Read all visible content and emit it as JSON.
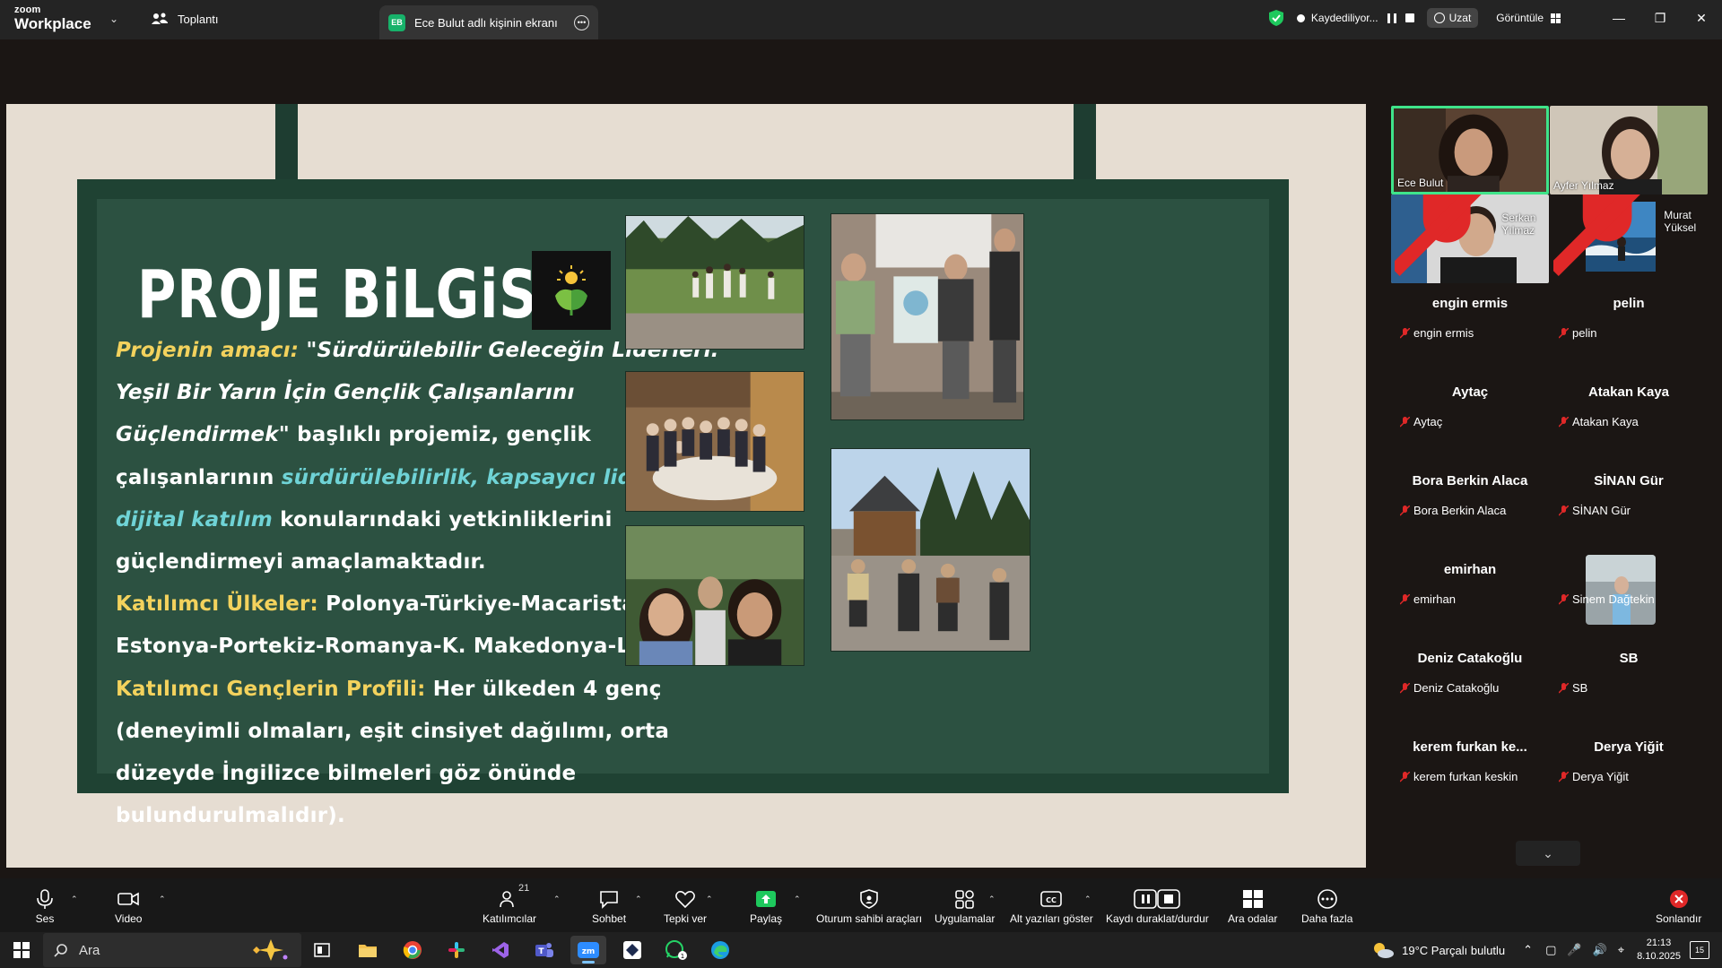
{
  "app": {
    "logo_line1": "zoom",
    "logo_line2": "Workplace",
    "meeting_tab": "Toplantı",
    "screen_tab_badge": "EB",
    "screen_tab_label": "Ece Bulut adlı kişinin ekranı",
    "recording_label": "Kaydediliyor...",
    "extend_label": "Uzat",
    "view_label": "Görüntüle"
  },
  "slide": {
    "title": "PROJE BiLGiSi",
    "purpose_label": "Projenin amacı:",
    "purpose_quote": "\"Sürdürülebilir Geleceğin Liderleri: Yeşil Bir Yarın İçin Gençlik Çalışanlarını Güçlendirmek\"",
    "purpose_mid": " başlıklı projemiz, gençlik çalışanlarının ",
    "purpose_topics": "sürdürülebilirlik, kapsayıcı liderlik ve dijital katılım",
    "purpose_end": " konularındaki yetkinliklerini güçlendirmeyi amaçlamaktadır.",
    "countries_label": "Katılımcı Ülkeler:",
    "countries_value": " Polonya-Türkiye-Macaristan-Estonya-Portekiz-Romanya-K. Makedonya-Litvanya",
    "profile_label": "Katılımcı Gençlerin Profili:",
    "profile_value": " Her ülkeden 4 genç (deneyimli olmaları, eşit cinsiyet dağılımı, orta düzeyde İngilizce bilmeleri göz önünde bulundurulmalıdır)."
  },
  "gallery": {
    "video_tiles": [
      {
        "name": "Ece Bulut",
        "muted": false,
        "active": true
      },
      {
        "name": "Ayfer Yılmaz",
        "muted": false,
        "active": false
      },
      {
        "name": "Serkan Yılmaz",
        "muted": true,
        "active": false
      },
      {
        "name": "Murat Yüksel",
        "muted": true,
        "active": false
      }
    ],
    "participants": [
      {
        "title": "engin ermis",
        "label": "engin ermis"
      },
      {
        "title": "pelin",
        "label": "pelin"
      },
      {
        "title": "Aytaç",
        "label": "Aytaç"
      },
      {
        "title": "Atakan Kaya",
        "label": "Atakan Kaya"
      },
      {
        "title": "Bora Berkin Alaca",
        "label": "Bora Berkin Alaca"
      },
      {
        "title": "SİNAN Gür",
        "label": "SİNAN Gür"
      },
      {
        "title": "emirhan",
        "label": "emirhan"
      },
      {
        "title": "",
        "label": "Sinem Dağtekin"
      },
      {
        "title": "Deniz Catakoğlu",
        "label": "Deniz Catakoğlu"
      },
      {
        "title": "SB",
        "label": "SB"
      },
      {
        "title": "kerem furkan ke...",
        "label": "kerem furkan keskin"
      },
      {
        "title": "Derya Yiğit",
        "label": "Derya Yiğit"
      }
    ]
  },
  "toolbar": {
    "audio": "Ses",
    "video": "Video",
    "participants": "Katılımcılar",
    "participants_count": "21",
    "chat": "Sohbet",
    "react": "Tepki ver",
    "share": "Paylaş",
    "host_tools": "Oturum sahibi araçları",
    "apps": "Uygulamalar",
    "captions": "Alt yazıları göster",
    "record": "Kaydı duraklat/durdur",
    "breakout": "Ara odalar",
    "more": "Daha fazla",
    "end": "Sonlandır"
  },
  "taskbar": {
    "search_placeholder": "Ara",
    "weather": "19°C  Parçalı bulutlu",
    "time": "21:13",
    "date": "8.10.2025",
    "notifications": "15"
  },
  "colors": {
    "slide_bg": "#2c5141",
    "slide_border": "#1f4233",
    "accent_yellow": "#f3d25d",
    "accent_cyan": "#6fd3d6",
    "active_speaker": "#3fe48a",
    "end_button": "#e02828"
  }
}
